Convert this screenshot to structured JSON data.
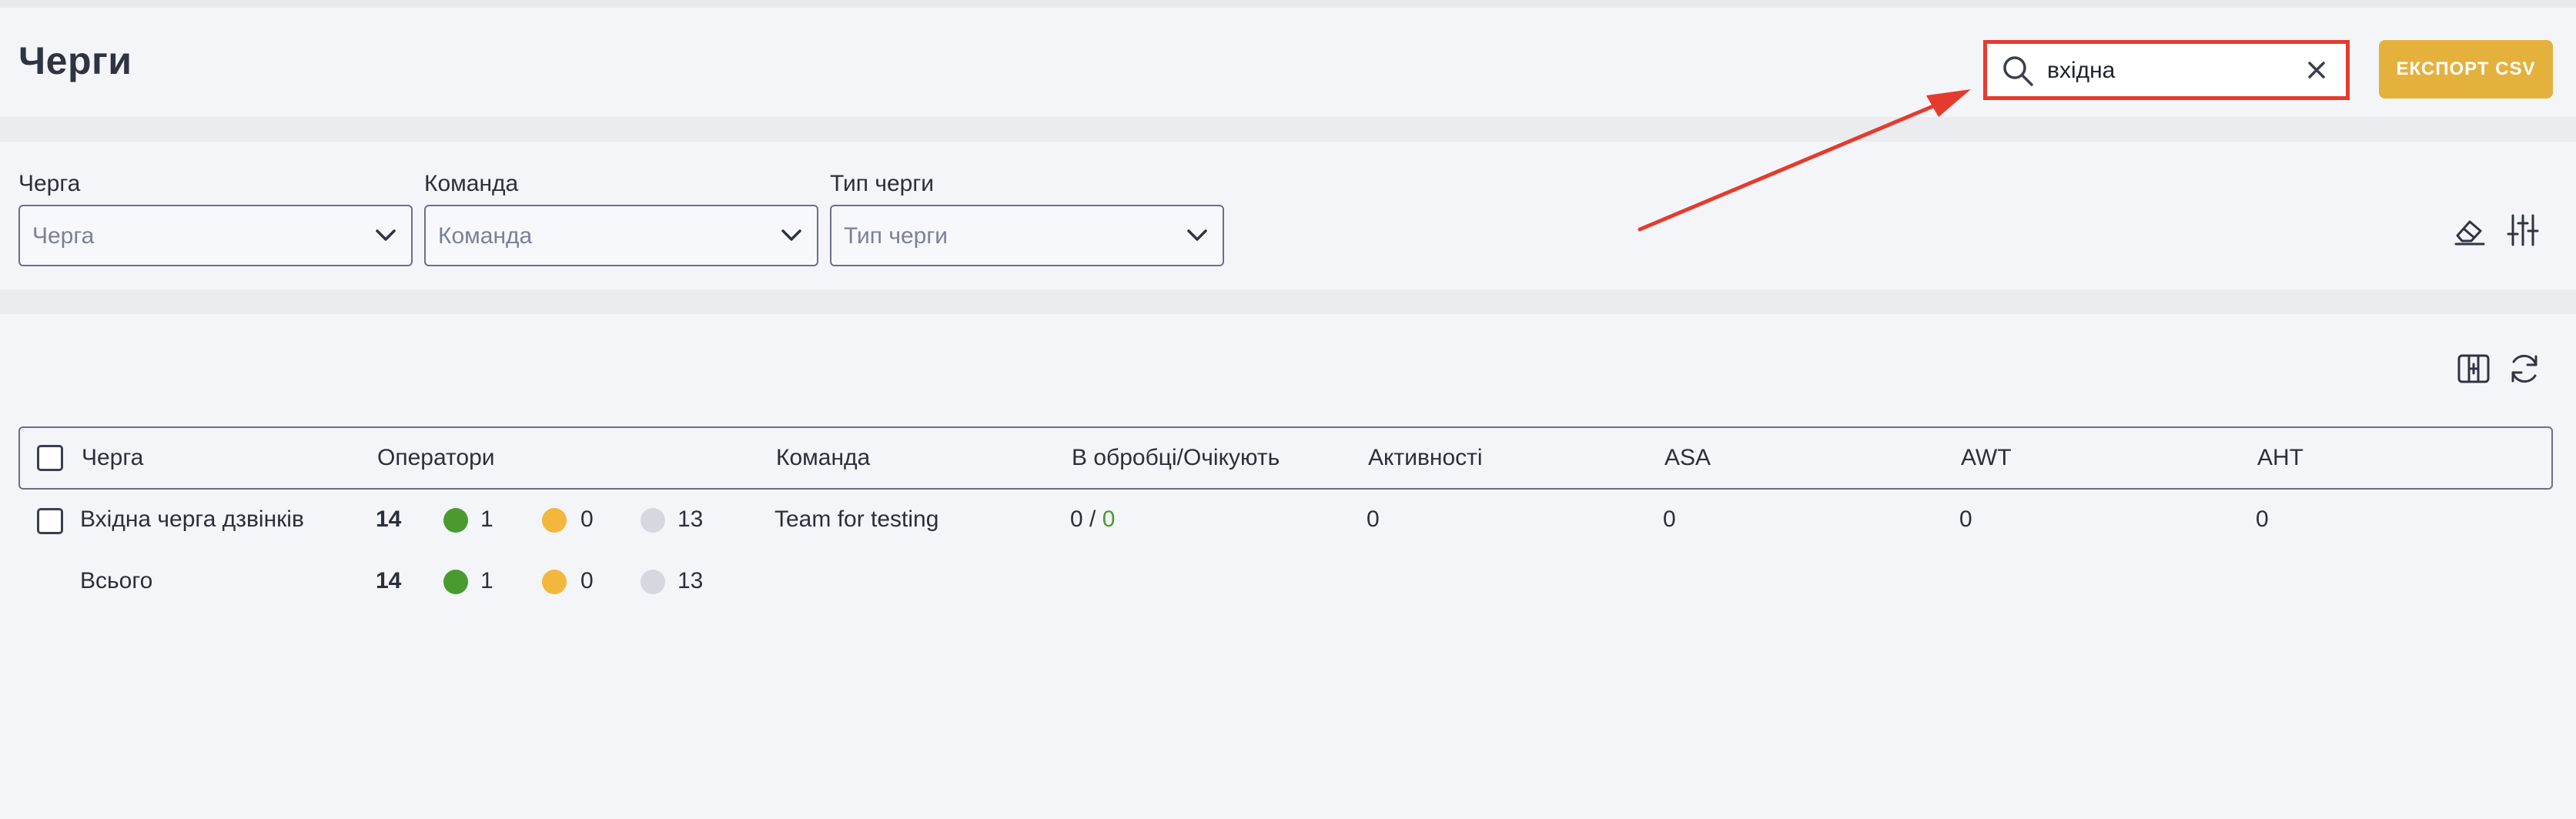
{
  "header": {
    "title": "Черги",
    "search_value": "вхідна",
    "export_label": "ЕКСПОРТ CSV"
  },
  "filters": [
    {
      "label": "Черга",
      "placeholder": "Черга"
    },
    {
      "label": "Команда",
      "placeholder": "Команда"
    },
    {
      "label": "Тип черги",
      "placeholder": "Тип черги"
    }
  ],
  "table": {
    "columns": [
      "Черга",
      "Оператори",
      "Команда",
      "В обробці/Очікують",
      "Активності",
      "ASA",
      "AWT",
      "AHT"
    ],
    "rows": [
      {
        "queue": "Вхідна черга дзвінків",
        "operators_total": "14",
        "green": "1",
        "yellow": "0",
        "gray": "13",
        "team": "Team for testing",
        "in_progress": "0",
        "separator": " / ",
        "waiting": "0",
        "activities": "0",
        "asa": "0",
        "awt": "0",
        "aht": "0"
      }
    ],
    "total": {
      "label": "Всього",
      "operators_total": "14",
      "green": "1",
      "yellow": "0",
      "gray": "13"
    }
  },
  "colors": {
    "accent": "#e5b13d",
    "highlight": "#e53b2c",
    "status_online": "#4a9a2f",
    "status_busy": "#f2b73b",
    "status_offline": "#d7d8df"
  },
  "icons": [
    "search-icon",
    "close-icon",
    "chevron-down-icon",
    "eraser-icon",
    "sliders-icon",
    "columns-icon",
    "refresh-icon"
  ]
}
